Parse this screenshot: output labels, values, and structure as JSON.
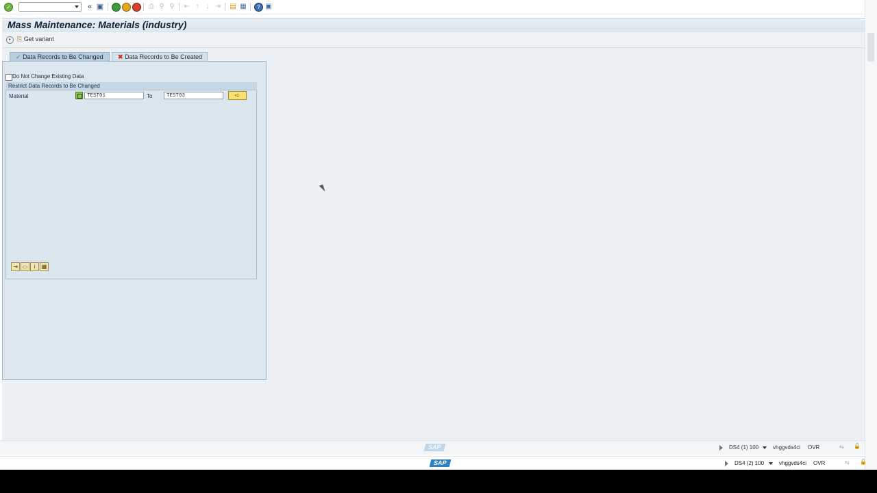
{
  "toolbar": {
    "command_value": "",
    "icons": [
      "enter-icon",
      "back-icon",
      "save-icon",
      "back-green-icon",
      "exit-icon",
      "cancel-icon",
      "print-icon",
      "find-icon",
      "find-next-icon",
      "first-page-icon",
      "prev-page-icon",
      "next-page-icon",
      "last-page-icon",
      "new-session-icon",
      "shortcut-icon",
      "help-icon",
      "customize-icon"
    ]
  },
  "title": "Mass Maintenance: Materials (industry)",
  "appbar": {
    "get_variant": "Get variant"
  },
  "tabs": [
    {
      "label": "Data Records to Be Changed",
      "icon": "check-icon",
      "active": true
    },
    {
      "label": "Data Records to Be Created",
      "icon": "cross-icon",
      "active": false
    }
  ],
  "form": {
    "do_not_change_label": "Do Not Change Existing Data",
    "do_not_change_checked": false,
    "group_title": "Restrict Data Records to Be Changed",
    "material_label": "Material",
    "material_from": "TEST01",
    "to_label": "To",
    "material_to": "TEST03"
  },
  "status": {
    "logo": "SAP",
    "line1": {
      "system": "DS4 (1) 100",
      "server": "vhggvds4ci",
      "mode": "OVR"
    },
    "line2": {
      "system": "DS4 (2) 100",
      "server": "vhggvds4ci",
      "mode": "OVR"
    }
  },
  "colors": {
    "accent": "#2a81c4",
    "panel": "#dde7ef",
    "title_bg": "#e2eaf1"
  }
}
